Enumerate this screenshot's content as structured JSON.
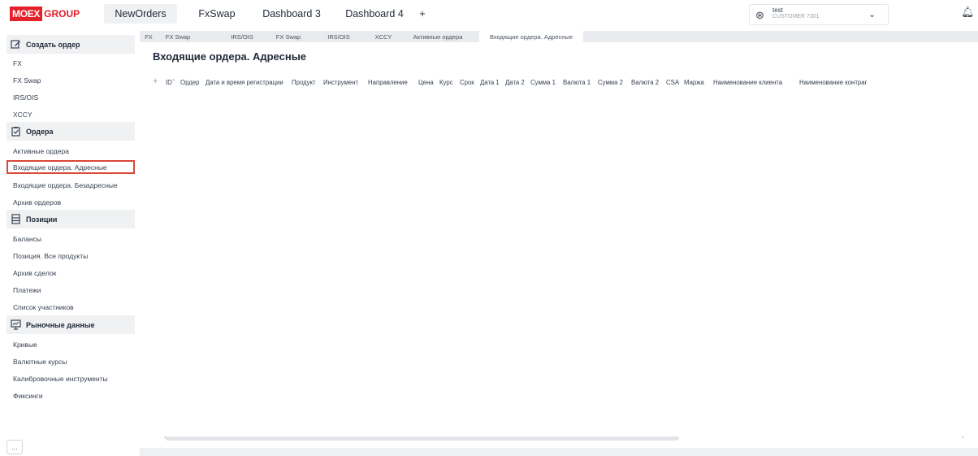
{
  "logo": {
    "box": "MOEX",
    "group": "GROUP"
  },
  "top_tabs": [
    {
      "label": "NewOrders",
      "active": true
    },
    {
      "label": "FxSwap"
    },
    {
      "label": "Dashboard 3"
    },
    {
      "label": "Dashboard 4"
    },
    {
      "label": "+"
    }
  ],
  "user": {
    "name": "test",
    "sub": "CUSTOMER 7301",
    "icon": "user-circle-icon"
  },
  "sidebar": {
    "create_order": {
      "title": "Создать ордер",
      "items": [
        "FX",
        "FX Swap",
        "IRS/OIS",
        "XCCY"
      ]
    },
    "orders": {
      "title": "Ордера",
      "items": [
        "Активные ордера",
        "Входящие ордера. Адресные",
        "Входящие ордера. Безадресные",
        "Архив ордеров"
      ]
    },
    "positions": {
      "title": "Позиции",
      "items": [
        "Балансы",
        "Позиция. Все продукты",
        "Архив сделок",
        "Платежи",
        "Список участников"
      ]
    },
    "market": {
      "title": "Рыночные данные",
      "items": [
        "Кривые",
        "Валютные курсы",
        "Калибровочные инструменты",
        "Фиксинги"
      ]
    },
    "more": "..."
  },
  "sub_tabs": [
    {
      "label": "FX"
    },
    {
      "label": "FX Swap"
    },
    {
      "label": "IRS/OIS"
    },
    {
      "label": "FX Swap"
    },
    {
      "label": "IRS/OIS"
    },
    {
      "label": "XCCY"
    },
    {
      "label": "Активные ордера"
    },
    {
      "label": "Входящие ордера. Адресные",
      "active": true
    }
  ],
  "page_title": "Входящие ордера. Адресные",
  "table": {
    "add": "+",
    "columns": [
      "ID",
      "Ордер",
      "Дата и время регистрации",
      "Продукт",
      "Инструмент",
      "Направление",
      "Цена",
      "Курс",
      "Срок",
      "Дата 1",
      "Дата 2",
      "Сумма 1",
      "Валюта 1",
      "Сумма 2",
      "Валюта 2",
      "CSA",
      "Маржа",
      "Наименование клиента",
      "Наименование контраг"
    ],
    "sort_marker": "˄"
  },
  "colors": {
    "brand": "#e4202a",
    "highlight_border": "#d9483b",
    "panel": "#f0f1f3"
  }
}
